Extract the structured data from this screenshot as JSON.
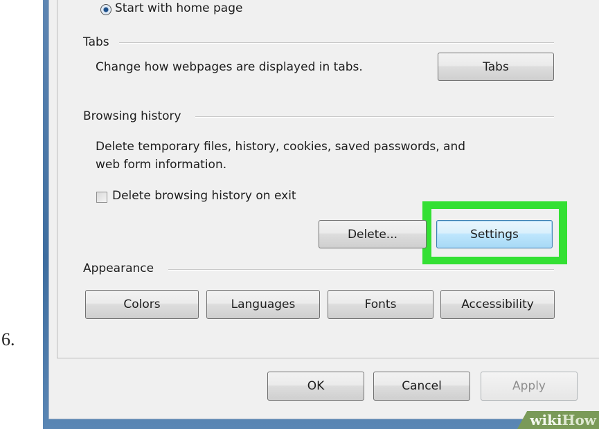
{
  "step_number": "6.",
  "home_page": {
    "start_option_label": "Start with home page"
  },
  "tabs_group": {
    "title": "Tabs",
    "description": "Change how webpages are displayed in tabs.",
    "button_label": "Tabs"
  },
  "browsing_history": {
    "title": "Browsing history",
    "description_line1": "Delete temporary files, history, cookies, saved passwords, and",
    "description_line2": "web form information.",
    "checkbox_label": "Delete browsing history on exit",
    "checkbox_checked": false,
    "delete_label": "Delete...",
    "settings_label": "Settings",
    "highlight_color": "#33e033"
  },
  "appearance": {
    "title": "Appearance",
    "buttons": [
      "Colors",
      "Languages",
      "Fonts",
      "Accessibility"
    ]
  },
  "footer": {
    "ok_label": "OK",
    "cancel_label": "Cancel",
    "apply_label": "Apply"
  },
  "watermark": {
    "part1": "wiki",
    "part2": "How"
  }
}
